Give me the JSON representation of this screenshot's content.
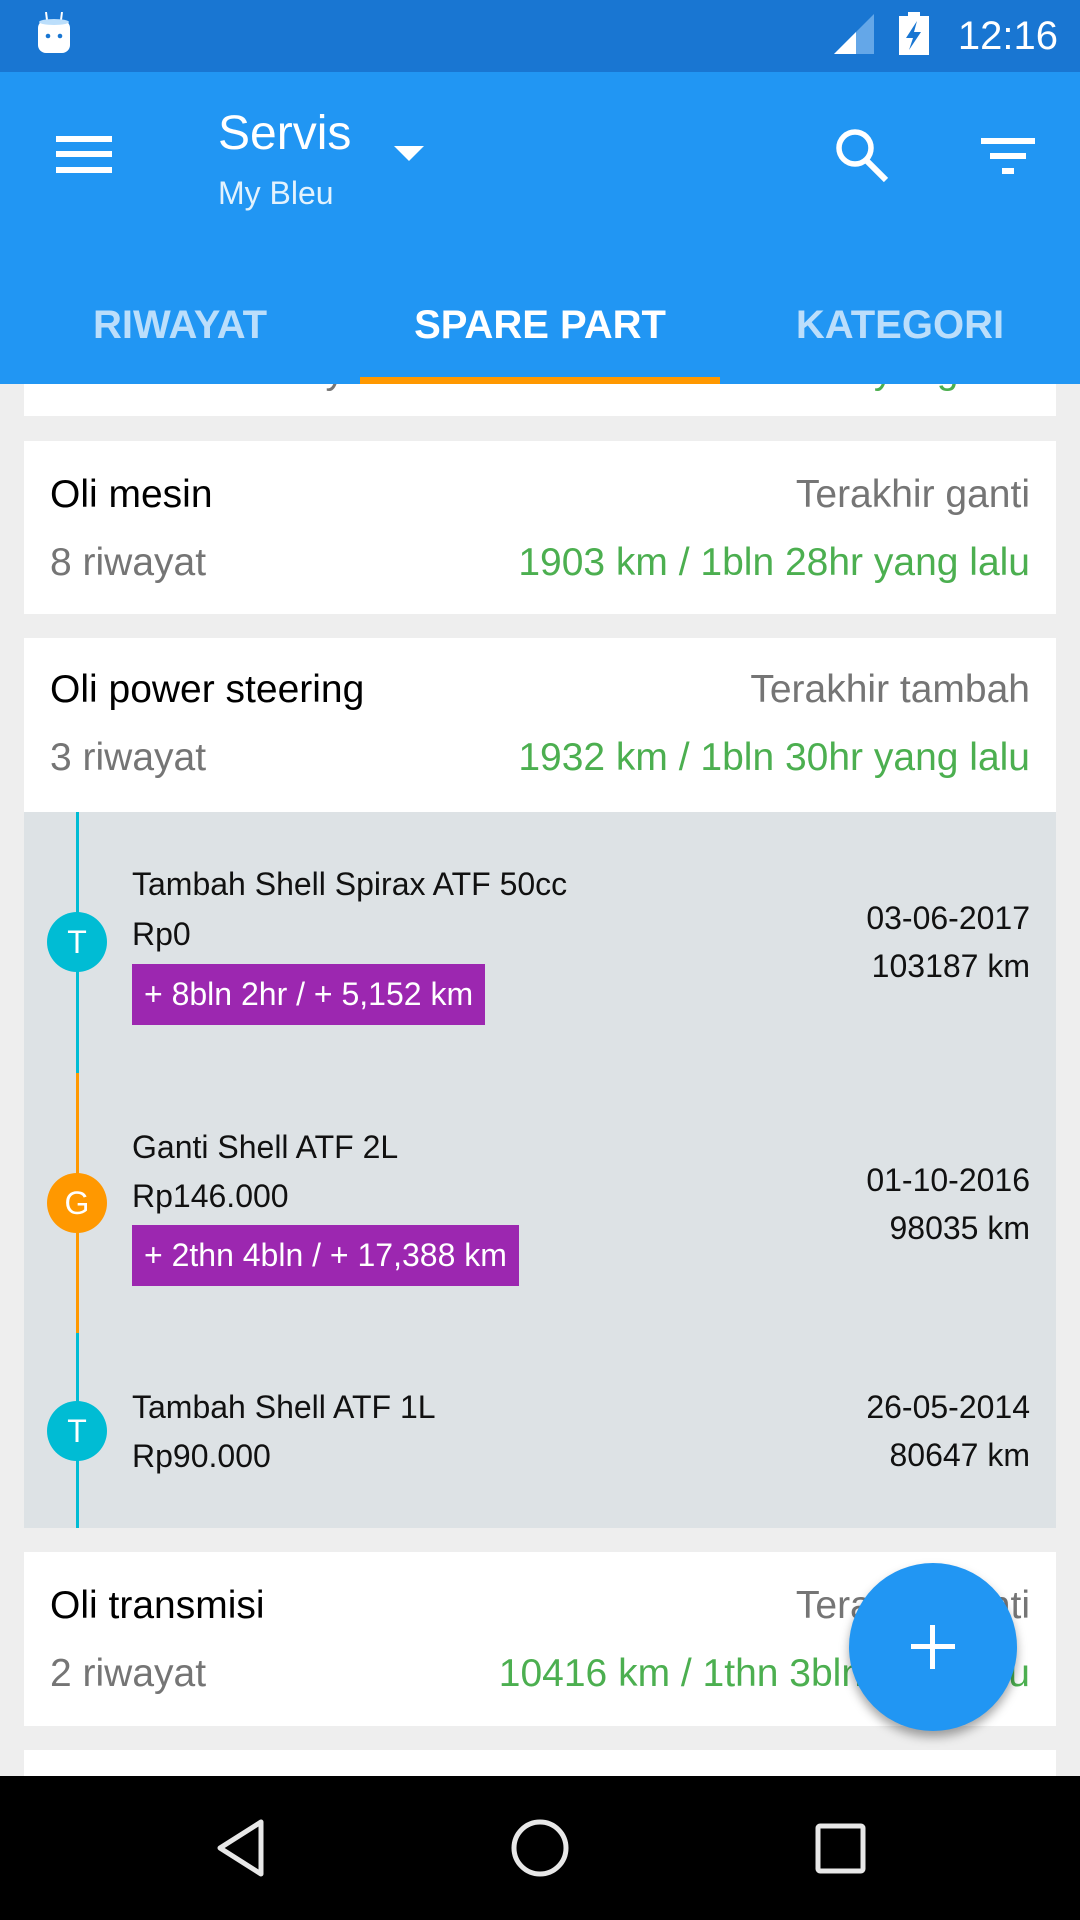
{
  "status_bar": {
    "time": "12:16",
    "notification_icon": "android-icon",
    "signal_icon": "cell-signal-icon",
    "battery_icon": "battery-charging-icon"
  },
  "toolbar": {
    "menu_icon": "hamburger-menu-icon",
    "title": "Servis",
    "subtitle": "My Bleu",
    "dropdown_icon": "dropdown-arrow-icon",
    "search_icon": "search-icon",
    "filter_icon": "filter-icon"
  },
  "tabs": [
    {
      "label": "RIWAYAT",
      "active": false
    },
    {
      "label": "SPARE PART",
      "active": true
    },
    {
      "label": "KATEGORI",
      "active": false
    }
  ],
  "colors": {
    "status_bar": "#1976D2",
    "primary": "#2196F3",
    "tab_indicator": "#FF9800",
    "last_change_green": "#4CAF50",
    "badge_purple": "#9C27B0",
    "timeline_add": "#00BCD4",
    "timeline_replace": "#FF9800",
    "expanded_bg": "#DDE2E5"
  },
  "parts": [
    {
      "name": "Oli mesin",
      "count": "8 riwayat",
      "last_label": "Terakhir ganti",
      "last_value": "1903 km / 1bln 28hr yang lalu"
    },
    {
      "name": "Oli power steering",
      "count": "3 riwayat",
      "last_label": "Terakhir tambah",
      "last_value": "1932 km / 1bln 30hr yang lalu",
      "expanded": true,
      "history": [
        {
          "type_letter": "T",
          "type": "tambah",
          "title": "Tambah Shell Spirax ATF 50cc",
          "cost": "Rp0",
          "delta": "+ 8bln 2hr / + 5,152 km",
          "date": "03-06-2017",
          "odometer": "103187 km"
        },
        {
          "type_letter": "G",
          "type": "ganti",
          "title": "Ganti Shell ATF 2L",
          "cost": "Rp146.000",
          "delta": "+ 2thn 4bln / + 17,388 km",
          "date": "01-10-2016",
          "odometer": "98035 km"
        },
        {
          "type_letter": "T",
          "type": "tambah",
          "title": "Tambah Shell ATF 1L",
          "cost": "Rp90.000",
          "date": "26-05-2014",
          "odometer": "80647 km"
        }
      ]
    },
    {
      "name": "Oli transmisi",
      "count": "2 riwayat",
      "last_label": "Terakhir ganti",
      "last_value": "10416 km / 1thn 3bln yang lalu"
    }
  ],
  "partial_top": {
    "count": "riwayat",
    "last_value": "yang lalu"
  },
  "fab": {
    "icon": "plus-icon"
  },
  "nav_bar": {
    "back_icon": "back-icon",
    "home_icon": "home-icon",
    "recents_icon": "recents-icon"
  }
}
